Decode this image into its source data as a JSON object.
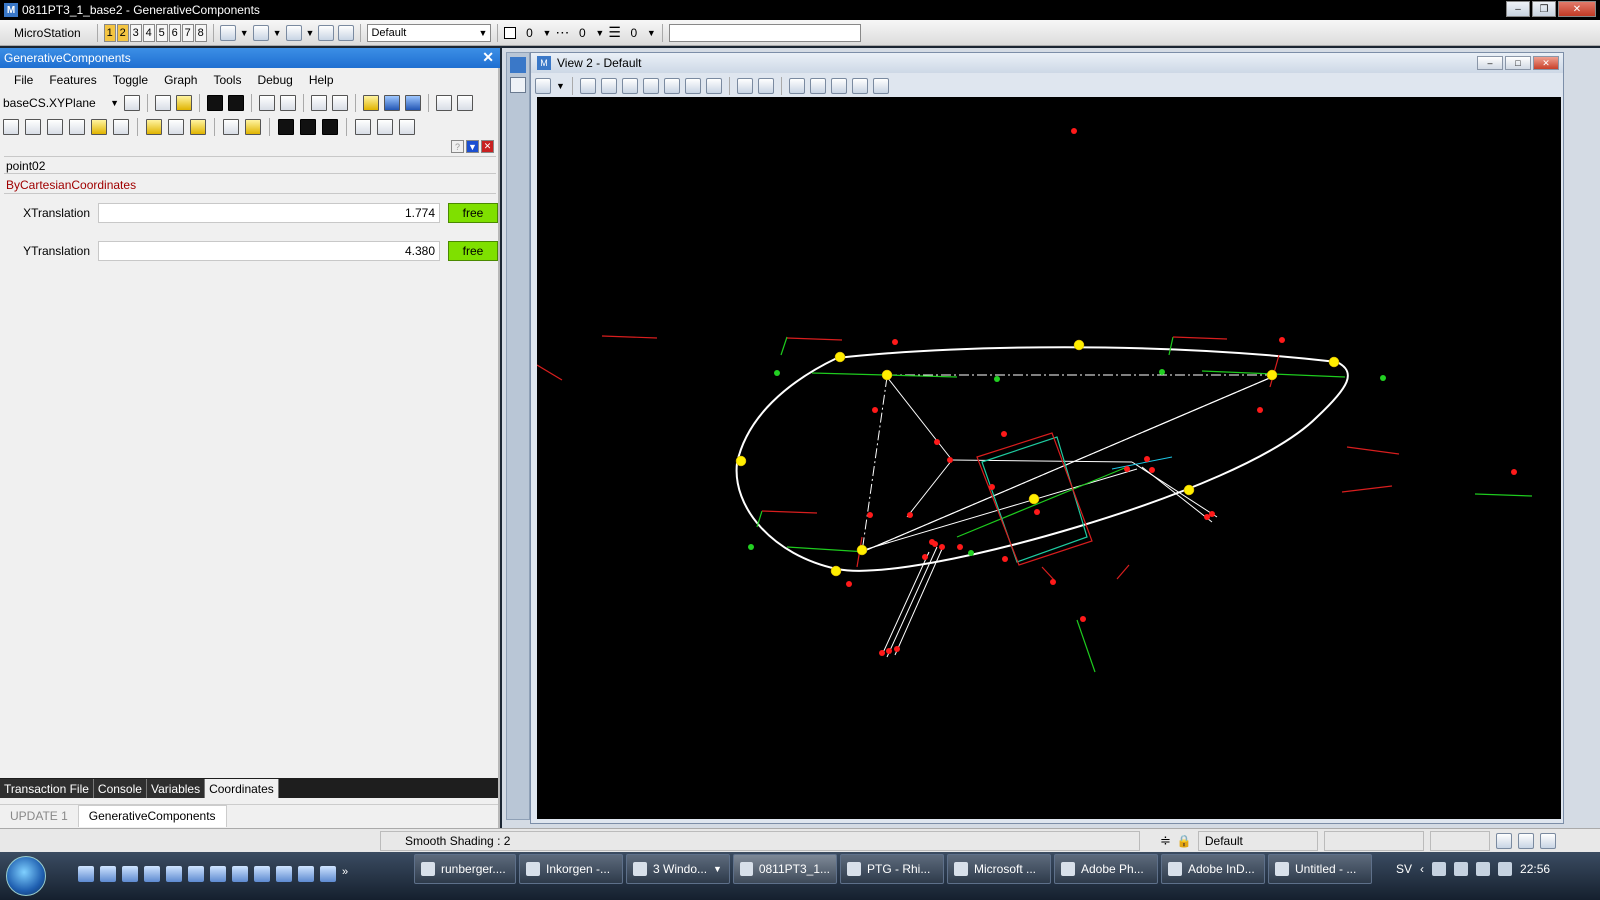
{
  "window": {
    "title": "0811PT3_1_base2 - GenerativeComponents"
  },
  "toolbar": {
    "app_label": "MicroStation",
    "view_numbers": [
      "1",
      "2",
      "3",
      "4",
      "5",
      "6",
      "7",
      "8"
    ],
    "level_combo": "Default",
    "color_value": "0",
    "style_value": "0",
    "weight_value": "0",
    "input_value": ""
  },
  "gc": {
    "title": "GenerativeComponents",
    "menu": [
      "File",
      "Features",
      "Toggle",
      "Graph",
      "Tools",
      "Debug",
      "Help"
    ],
    "cs_combo": "baseCS.XYPlane",
    "feature_name": "point02",
    "method_name": "ByCartesianCoordinates",
    "props": [
      {
        "label": "XTranslation",
        "value": "1.774",
        "state": "free"
      },
      {
        "label": "YTranslation",
        "value": "4.380",
        "state": "free"
      }
    ],
    "tabs": [
      "Transaction File",
      "Console",
      "Variables",
      "Coordinates"
    ],
    "active_tab": "Coordinates",
    "bottom_tabs": [
      "UPDATE 1",
      "GenerativeComponents"
    ]
  },
  "view": {
    "title": "View 2 - Default"
  },
  "status": {
    "message": "Smooth Shading : 2",
    "level": "Default"
  },
  "taskbar": {
    "tasks": [
      "runberger....",
      "Inkorgen -...",
      "3 Windo...",
      "0811PT3_1...",
      "PTG - Rhi...",
      "Microsoft ...",
      "Adobe Ph...",
      "Adobe InD...",
      "Untitled - ..."
    ],
    "lang": "SV",
    "clock": "22:56"
  },
  "colors": {
    "free_button": "#7fe000",
    "canvas_bg": "#000000",
    "gc_title_bar": "#1f6fd1"
  }
}
